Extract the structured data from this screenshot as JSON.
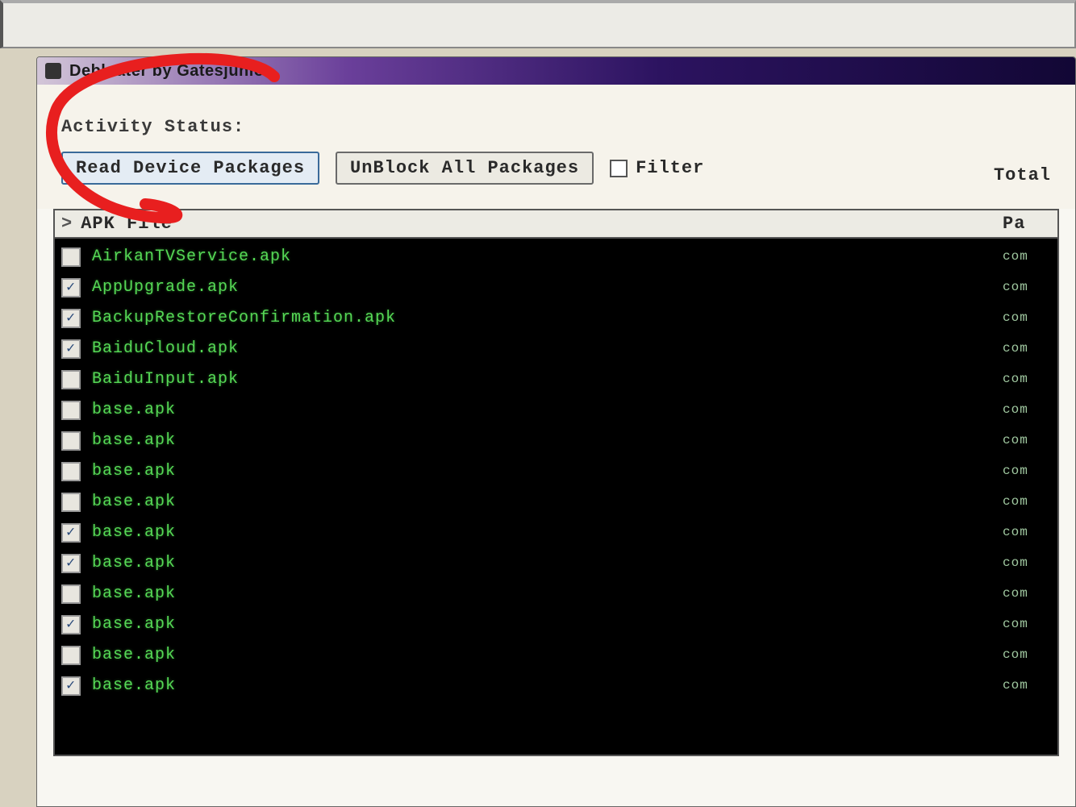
{
  "window": {
    "title": "Debloater by Gatesjunior"
  },
  "toolbar": {
    "status_label": "Activity Status:",
    "read_button": "Read Device Packages",
    "unblock_button": "UnBlock All Packages",
    "filter_label": "Filter",
    "total_label": "Total"
  },
  "list": {
    "sort_indicator": ">",
    "col_apk": "APK File",
    "col_pkg": "Pa",
    "rows": [
      {
        "checked": false,
        "name": "AirkanTVService.apk",
        "pkg": "com"
      },
      {
        "checked": true,
        "name": "AppUpgrade.apk",
        "pkg": "com"
      },
      {
        "checked": true,
        "name": "BackupRestoreConfirmation.apk",
        "pkg": "com"
      },
      {
        "checked": true,
        "name": "BaiduCloud.apk",
        "pkg": "com"
      },
      {
        "checked": false,
        "name": "BaiduInput.apk",
        "pkg": "com"
      },
      {
        "checked": false,
        "name": "base.apk",
        "pkg": "com"
      },
      {
        "checked": false,
        "name": "base.apk",
        "pkg": "com"
      },
      {
        "checked": false,
        "name": "base.apk",
        "pkg": "com"
      },
      {
        "checked": false,
        "name": "base.apk",
        "pkg": "com"
      },
      {
        "checked": true,
        "name": "base.apk",
        "pkg": "com"
      },
      {
        "checked": true,
        "name": "base.apk",
        "pkg": "com"
      },
      {
        "checked": false,
        "name": "base.apk",
        "pkg": "com"
      },
      {
        "checked": true,
        "name": "base.apk",
        "pkg": "com"
      },
      {
        "checked": false,
        "name": "base.apk",
        "pkg": "com"
      },
      {
        "checked": true,
        "name": "base.apk",
        "pkg": "com"
      }
    ]
  },
  "annotation": {
    "color": "#e81f1f"
  }
}
